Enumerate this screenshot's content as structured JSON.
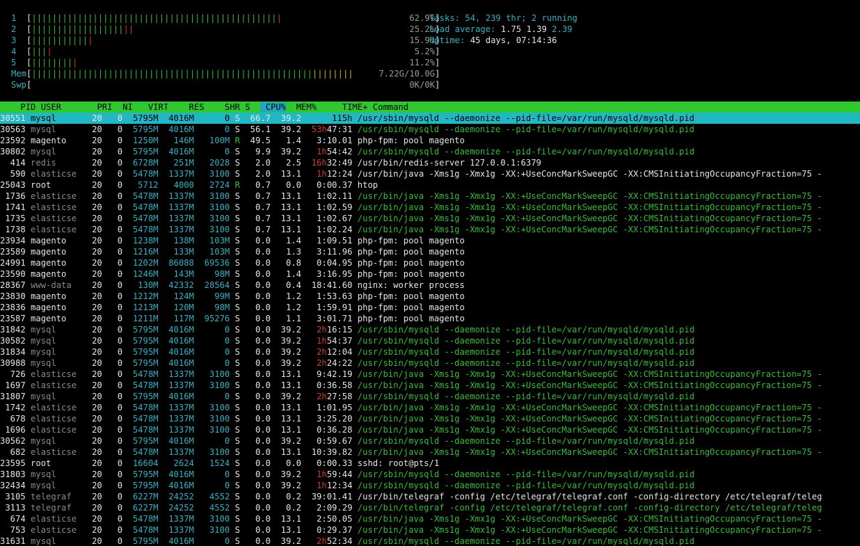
{
  "header": {
    "cpus": [
      {
        "label": "1",
        "green": 48,
        "red": 1,
        "pct": "62.9%"
      },
      {
        "label": "2",
        "green": 18,
        "red": 2,
        "pct": "25.2%"
      },
      {
        "label": "3",
        "green": 11,
        "red": 1,
        "pct": "15.9%"
      },
      {
        "label": "4",
        "green": 3,
        "red": 1,
        "pct": "5.2%"
      },
      {
        "label": "5",
        "green": 8,
        "red": 1,
        "pct": "11.2%"
      }
    ],
    "mem": {
      "label": "Mem",
      "green": 55,
      "yellow": 8,
      "value": "7.22G/10.0G"
    },
    "swp": {
      "label": "Swp",
      "value": "0K/0K"
    },
    "tasks_label": "Tasks:",
    "tasks_value": "54,",
    "threads_value": "239",
    "threads_label": "thr;",
    "running_value": "2",
    "running_label": "running",
    "load_label": "Load average:",
    "load_1": "1.75",
    "load_5": "1.39",
    "load_15": "2.39",
    "uptime_label": "Uptime:",
    "uptime_value": "45 days, 07:14:36"
  },
  "columns": [
    "PID",
    "USER",
    "PRI",
    "NI",
    "VIRT",
    "RES",
    "SHR",
    "S",
    "CPU%",
    "MEM%",
    "TIME+",
    "Command"
  ],
  "sort_column": "CPU%",
  "colors": {
    "green": "#2fbf2f",
    "cyan": "#2ab3c4",
    "red": "#d03a2a",
    "yellow": "#c9b12a",
    "header_bg": "#2fc92f",
    "selected_bg": "#1fb8c4"
  },
  "processes": [
    {
      "pid": "30551",
      "user": "mysql",
      "pri": "20",
      "ni": "0",
      "virt": "5795M",
      "res": "4016M",
      "shr": "0",
      "s": "S",
      "cpu": "66.7",
      "mem": "39.2",
      "time_h": "",
      "time": "115h",
      "cmd": "/usr/sbin/mysqld --daemonize --pid-file=/var/run/mysqld/mysqld.pid",
      "thread": false,
      "selected": true
    },
    {
      "pid": "30563",
      "user": "mysql",
      "pri": "20",
      "ni": "0",
      "virt": "5795M",
      "res": "4016M",
      "shr": "0",
      "s": "S",
      "cpu": "56.1",
      "mem": "39.2",
      "time_h": "53h",
      "time": "47:31",
      "cmd": "/usr/sbin/mysqld --daemonize --pid-file=/var/run/mysqld/mysqld.pid",
      "thread": true
    },
    {
      "pid": "23592",
      "user": "magento",
      "pri": "20",
      "ni": "0",
      "virt": "1250M",
      "res": "146M",
      "shr": "100M",
      "s": "R",
      "cpu": "49.5",
      "mem": "1.4",
      "time_h": "",
      "time": "3:10.01",
      "cmd": "php-fpm: pool magento",
      "thread": false
    },
    {
      "pid": "30802",
      "user": "mysql",
      "pri": "20",
      "ni": "0",
      "virt": "5795M",
      "res": "4016M",
      "shr": "0",
      "s": "S",
      "cpu": "9.9",
      "mem": "39.2",
      "time_h": "1h",
      "time": "54:42",
      "cmd": "/usr/sbin/mysqld --daemonize --pid-file=/var/run/mysqld/mysqld.pid",
      "thread": true
    },
    {
      "pid": "414",
      "user": "redis",
      "pri": "20",
      "ni": "0",
      "virt": "6728M",
      "res": "251M",
      "shr": "2028",
      "s": "S",
      "cpu": "2.0",
      "mem": "2.5",
      "time_h": "16h",
      "time": "32:49",
      "cmd": "/usr/bin/redis-server 127.0.0.1:6379",
      "thread": false
    },
    {
      "pid": "590",
      "user": "elasticse",
      "pri": "20",
      "ni": "0",
      "virt": "5478M",
      "res": "1337M",
      "shr": "3100",
      "s": "S",
      "cpu": "2.0",
      "mem": "13.1",
      "time_h": "1h",
      "time": "12:24",
      "cmd": "/usr/bin/java -Xms1g -Xmx1g -XX:+UseConcMarkSweepGC -XX:CMSInitiatingOccupancyFraction=75 -",
      "thread": false
    },
    {
      "pid": "25043",
      "user": "root",
      "pri": "20",
      "ni": "0",
      "virt": "5712",
      "res": "4000",
      "shr": "2724",
      "s": "R",
      "cpu": "0.7",
      "mem": "0.0",
      "time_h": "",
      "time": "0:00.37",
      "cmd": "htop",
      "thread": false
    },
    {
      "pid": "1736",
      "user": "elasticse",
      "pri": "20",
      "ni": "0",
      "virt": "5478M",
      "res": "1337M",
      "shr": "3100",
      "s": "S",
      "cpu": "0.7",
      "mem": "13.1",
      "time_h": "",
      "time": "1:02.11",
      "cmd": "/usr/bin/java -Xms1g -Xmx1g -XX:+UseConcMarkSweepGC -XX:CMSInitiatingOccupancyFraction=75 -",
      "thread": true
    },
    {
      "pid": "1741",
      "user": "elasticse",
      "pri": "20",
      "ni": "0",
      "virt": "5478M",
      "res": "1337M",
      "shr": "3100",
      "s": "S",
      "cpu": "0.7",
      "mem": "13.1",
      "time_h": "",
      "time": "1:02.59",
      "cmd": "/usr/bin/java -Xms1g -Xmx1g -XX:+UseConcMarkSweepGC -XX:CMSInitiatingOccupancyFraction=75 -",
      "thread": true
    },
    {
      "pid": "1735",
      "user": "elasticse",
      "pri": "20",
      "ni": "0",
      "virt": "5478M",
      "res": "1337M",
      "shr": "3100",
      "s": "S",
      "cpu": "0.7",
      "mem": "13.1",
      "time_h": "",
      "time": "1:02.67",
      "cmd": "/usr/bin/java -Xms1g -Xmx1g -XX:+UseConcMarkSweepGC -XX:CMSInitiatingOccupancyFraction=75 -",
      "thread": true
    },
    {
      "pid": "1738",
      "user": "elasticse",
      "pri": "20",
      "ni": "0",
      "virt": "5478M",
      "res": "1337M",
      "shr": "3100",
      "s": "S",
      "cpu": "0.7",
      "mem": "13.1",
      "time_h": "",
      "time": "1:02.24",
      "cmd": "/usr/bin/java -Xms1g -Xmx1g -XX:+UseConcMarkSweepGC -XX:CMSInitiatingOccupancyFraction=75 -",
      "thread": true
    },
    {
      "pid": "23934",
      "user": "magento",
      "pri": "20",
      "ni": "0",
      "virt": "1238M",
      "res": "138M",
      "shr": "103M",
      "s": "S",
      "cpu": "0.0",
      "mem": "1.4",
      "time_h": "",
      "time": "1:09.51",
      "cmd": "php-fpm: pool magento",
      "thread": false
    },
    {
      "pid": "23589",
      "user": "magento",
      "pri": "20",
      "ni": "0",
      "virt": "1216M",
      "res": "133M",
      "shr": "103M",
      "s": "S",
      "cpu": "0.0",
      "mem": "1.3",
      "time_h": "",
      "time": "3:11.96",
      "cmd": "php-fpm: pool magento",
      "thread": false
    },
    {
      "pid": "24991",
      "user": "magento",
      "pri": "20",
      "ni": "0",
      "virt": "1202M",
      "res": "86088",
      "shr": "69536",
      "s": "S",
      "cpu": "0.0",
      "mem": "0.8",
      "time_h": "",
      "time": "0:04.95",
      "cmd": "php-fpm: pool magento",
      "thread": false
    },
    {
      "pid": "23590",
      "user": "magento",
      "pri": "20",
      "ni": "0",
      "virt": "1246M",
      "res": "143M",
      "shr": "98M",
      "s": "S",
      "cpu": "0.0",
      "mem": "1.4",
      "time_h": "",
      "time": "3:16.95",
      "cmd": "php-fpm: pool magento",
      "thread": false
    },
    {
      "pid": "28367",
      "user": "www-data",
      "pri": "20",
      "ni": "0",
      "virt": "130M",
      "res": "42332",
      "shr": "28564",
      "s": "S",
      "cpu": "0.0",
      "mem": "0.4",
      "time_h": "",
      "time": "18:41.60",
      "cmd": "nginx: worker process",
      "thread": false
    },
    {
      "pid": "23830",
      "user": "magento",
      "pri": "20",
      "ni": "0",
      "virt": "1212M",
      "res": "124M",
      "shr": "99M",
      "s": "S",
      "cpu": "0.0",
      "mem": "1.2",
      "time_h": "",
      "time": "1:53.63",
      "cmd": "php-fpm: pool magento",
      "thread": false
    },
    {
      "pid": "23836",
      "user": "magento",
      "pri": "20",
      "ni": "0",
      "virt": "1213M",
      "res": "120M",
      "shr": "98M",
      "s": "S",
      "cpu": "0.0",
      "mem": "1.2",
      "time_h": "",
      "time": "1:59.91",
      "cmd": "php-fpm: pool magento",
      "thread": false
    },
    {
      "pid": "23587",
      "user": "magento",
      "pri": "20",
      "ni": "0",
      "virt": "1211M",
      "res": "117M",
      "shr": "95276",
      "s": "S",
      "cpu": "0.0",
      "mem": "1.1",
      "time_h": "",
      "time": "3:01.71",
      "cmd": "php-fpm: pool magento",
      "thread": false
    },
    {
      "pid": "31842",
      "user": "mysql",
      "pri": "20",
      "ni": "0",
      "virt": "5795M",
      "res": "4016M",
      "shr": "0",
      "s": "S",
      "cpu": "0.0",
      "mem": "39.2",
      "time_h": "2h",
      "time": "16:15",
      "cmd": "/usr/sbin/mysqld --daemonize --pid-file=/var/run/mysqld/mysqld.pid",
      "thread": true
    },
    {
      "pid": "30582",
      "user": "mysql",
      "pri": "20",
      "ni": "0",
      "virt": "5795M",
      "res": "4016M",
      "shr": "0",
      "s": "S",
      "cpu": "0.0",
      "mem": "39.2",
      "time_h": "1h",
      "time": "54:37",
      "cmd": "/usr/sbin/mysqld --daemonize --pid-file=/var/run/mysqld/mysqld.pid",
      "thread": true
    },
    {
      "pid": "31834",
      "user": "mysql",
      "pri": "20",
      "ni": "0",
      "virt": "5795M",
      "res": "4016M",
      "shr": "0",
      "s": "S",
      "cpu": "0.0",
      "mem": "39.2",
      "time_h": "2h",
      "time": "12:04",
      "cmd": "/usr/sbin/mysqld --daemonize --pid-file=/var/run/mysqld/mysqld.pid",
      "thread": true
    },
    {
      "pid": "30988",
      "user": "mysql",
      "pri": "20",
      "ni": "0",
      "virt": "5795M",
      "res": "4016M",
      "shr": "0",
      "s": "S",
      "cpu": "0.0",
      "mem": "39.2",
      "time_h": "2h",
      "time": "24:22",
      "cmd": "/usr/sbin/mysqld --daemonize --pid-file=/var/run/mysqld/mysqld.pid",
      "thread": true
    },
    {
      "pid": "726",
      "user": "elasticse",
      "pri": "20",
      "ni": "0",
      "virt": "5478M",
      "res": "1337M",
      "shr": "3100",
      "s": "S",
      "cpu": "0.0",
      "mem": "13.1",
      "time_h": "",
      "time": "9:42.19",
      "cmd": "/usr/bin/java -Xms1g -Xmx1g -XX:+UseConcMarkSweepGC -XX:CMSInitiatingOccupancyFraction=75 -",
      "thread": true
    },
    {
      "pid": "1697",
      "user": "elasticse",
      "pri": "20",
      "ni": "0",
      "virt": "5478M",
      "res": "1337M",
      "shr": "3100",
      "s": "S",
      "cpu": "0.0",
      "mem": "13.1",
      "time_h": "",
      "time": "0:36.58",
      "cmd": "/usr/bin/java -Xms1g -Xmx1g -XX:+UseConcMarkSweepGC -XX:CMSInitiatingOccupancyFraction=75 -",
      "thread": true
    },
    {
      "pid": "31807",
      "user": "mysql",
      "pri": "20",
      "ni": "0",
      "virt": "5795M",
      "res": "4016M",
      "shr": "0",
      "s": "S",
      "cpu": "0.0",
      "mem": "39.2",
      "time_h": "2h",
      "time": "27:58",
      "cmd": "/usr/sbin/mysqld --daemonize --pid-file=/var/run/mysqld/mysqld.pid",
      "thread": true
    },
    {
      "pid": "1742",
      "user": "elasticse",
      "pri": "20",
      "ni": "0",
      "virt": "5478M",
      "res": "1337M",
      "shr": "3100",
      "s": "S",
      "cpu": "0.0",
      "mem": "13.1",
      "time_h": "",
      "time": "1:01.95",
      "cmd": "/usr/bin/java -Xms1g -Xmx1g -XX:+UseConcMarkSweepGC -XX:CMSInitiatingOccupancyFraction=75 -",
      "thread": true
    },
    {
      "pid": "678",
      "user": "elasticse",
      "pri": "20",
      "ni": "0",
      "virt": "5478M",
      "res": "1337M",
      "shr": "3100",
      "s": "S",
      "cpu": "0.0",
      "mem": "13.1",
      "time_h": "",
      "time": "3:25.20",
      "cmd": "/usr/bin/java -Xms1g -Xmx1g -XX:+UseConcMarkSweepGC -XX:CMSInitiatingOccupancyFraction=75 -",
      "thread": true
    },
    {
      "pid": "1696",
      "user": "elasticse",
      "pri": "20",
      "ni": "0",
      "virt": "5478M",
      "res": "1337M",
      "shr": "3100",
      "s": "S",
      "cpu": "0.0",
      "mem": "13.1",
      "time_h": "",
      "time": "0:36.28",
      "cmd": "/usr/bin/java -Xms1g -Xmx1g -XX:+UseConcMarkSweepGC -XX:CMSInitiatingOccupancyFraction=75 -",
      "thread": true
    },
    {
      "pid": "30562",
      "user": "mysql",
      "pri": "20",
      "ni": "0",
      "virt": "5795M",
      "res": "4016M",
      "shr": "0",
      "s": "S",
      "cpu": "0.0",
      "mem": "39.2",
      "time_h": "",
      "time": "0:59.67",
      "cmd": "/usr/sbin/mysqld --daemonize --pid-file=/var/run/mysqld/mysqld.pid",
      "thread": true
    },
    {
      "pid": "682",
      "user": "elasticse",
      "pri": "20",
      "ni": "0",
      "virt": "5478M",
      "res": "1337M",
      "shr": "3100",
      "s": "S",
      "cpu": "0.0",
      "mem": "13.1",
      "time_h": "",
      "time": "10:39.82",
      "cmd": "/usr/bin/java -Xms1g -Xmx1g -XX:+UseConcMarkSweepGC -XX:CMSInitiatingOccupancyFraction=75 -",
      "thread": true
    },
    {
      "pid": "23595",
      "user": "root",
      "pri": "20",
      "ni": "0",
      "virt": "16604",
      "res": "2624",
      "shr": "1524",
      "s": "S",
      "cpu": "0.0",
      "mem": "0.0",
      "time_h": "",
      "time": "0:00.33",
      "cmd": "sshd: root@pts/1",
      "thread": false
    },
    {
      "pid": "31803",
      "user": "mysql",
      "pri": "20",
      "ni": "0",
      "virt": "5795M",
      "res": "4016M",
      "shr": "0",
      "s": "S",
      "cpu": "0.0",
      "mem": "39.2",
      "time_h": "1h",
      "time": "59:44",
      "cmd": "/usr/sbin/mysqld --daemonize --pid-file=/var/run/mysqld/mysqld.pid",
      "thread": true
    },
    {
      "pid": "32434",
      "user": "mysql",
      "pri": "20",
      "ni": "0",
      "virt": "5795M",
      "res": "4016M",
      "shr": "0",
      "s": "S",
      "cpu": "0.0",
      "mem": "39.2",
      "time_h": "1h",
      "time": "12:34",
      "cmd": "/usr/sbin/mysqld --daemonize --pid-file=/var/run/mysqld/mysqld.pid",
      "thread": true
    },
    {
      "pid": "3105",
      "user": "telegraf",
      "pri": "20",
      "ni": "0",
      "virt": "6227M",
      "res": "24252",
      "shr": "4552",
      "s": "S",
      "cpu": "0.0",
      "mem": "0.2",
      "time_h": "",
      "time": "39:01.41",
      "cmd": "/usr/bin/telegraf -config /etc/telegraf/telegraf.conf -config-directory /etc/telegraf/teleg",
      "thread": false
    },
    {
      "pid": "3113",
      "user": "telegraf",
      "pri": "20",
      "ni": "0",
      "virt": "6227M",
      "res": "24252",
      "shr": "4552",
      "s": "S",
      "cpu": "0.0",
      "mem": "0.2",
      "time_h": "",
      "time": "2:09.29",
      "cmd": "/usr/bin/telegraf -config /etc/telegraf/telegraf.conf -config-directory /etc/telegraf/teleg",
      "thread": true
    },
    {
      "pid": "674",
      "user": "elasticse",
      "pri": "20",
      "ni": "0",
      "virt": "5478M",
      "res": "1337M",
      "shr": "3100",
      "s": "S",
      "cpu": "0.0",
      "mem": "13.1",
      "time_h": "",
      "time": "2:50.05",
      "cmd": "/usr/bin/java -Xms1g -Xmx1g -XX:+UseConcMarkSweepGC -XX:CMSInitiatingOccupancyFraction=75 -",
      "thread": true
    },
    {
      "pid": "753",
      "user": "elasticse",
      "pri": "20",
      "ni": "0",
      "virt": "5478M",
      "res": "1337M",
      "shr": "3100",
      "s": "S",
      "cpu": "0.0",
      "mem": "13.1",
      "time_h": "",
      "time": "0:29.37",
      "cmd": "/usr/bin/java -Xms1g -Xmx1g -XX:+UseConcMarkSweepGC -XX:CMSInitiatingOccupancyFraction=75 -",
      "thread": true
    },
    {
      "pid": "31631",
      "user": "mysql",
      "pri": "20",
      "ni": "0",
      "virt": "5795M",
      "res": "4016M",
      "shr": "0",
      "s": "S",
      "cpu": "0.0",
      "mem": "39.2",
      "time_h": "2h",
      "time": "52:34",
      "cmd": "/usr/sbin/mysqld --daemonize --pid-file=/var/run/mysqld/mysqld.pid",
      "thread": true
    }
  ]
}
